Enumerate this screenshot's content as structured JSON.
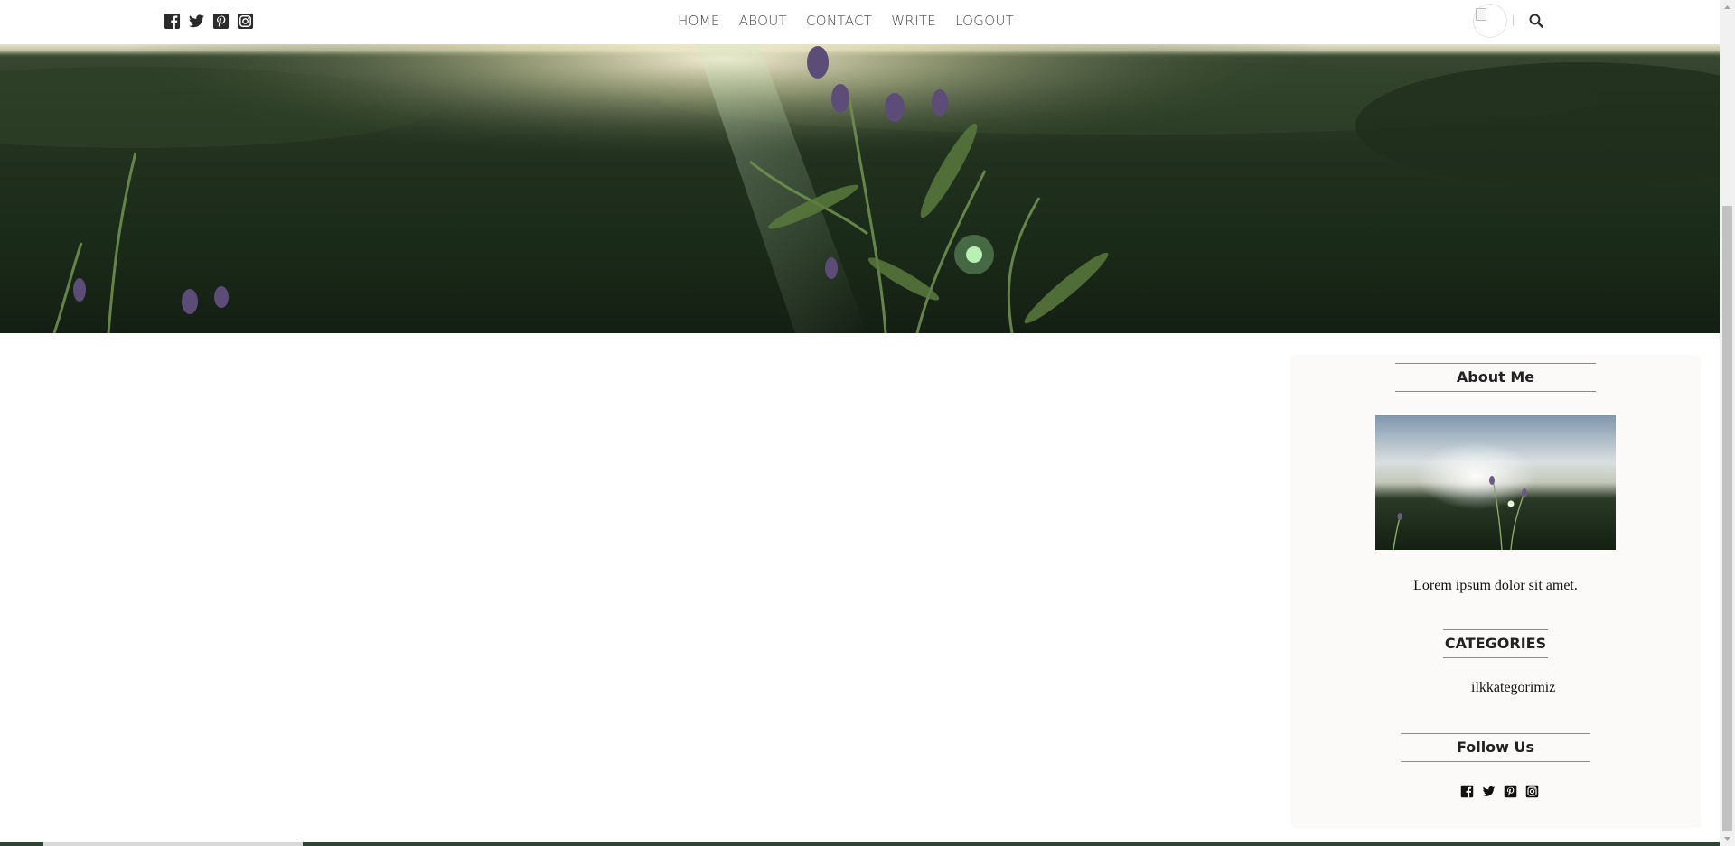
{
  "header": {
    "social_icons": [
      "facebook-square-icon",
      "twitter-icon",
      "pinterest-square-icon",
      "instagram-icon"
    ],
    "nav": [
      "HOME",
      "ABOUT",
      "CONTACT",
      "WRITE",
      "LOGOUT"
    ],
    "right_icons": [
      "avatar",
      "search-icon"
    ]
  },
  "sidebar": {
    "about": {
      "title": "About Me",
      "text": "Lorem ipsum dolor sit amet."
    },
    "categories": {
      "title": "CATEGORIES",
      "items": [
        "ilkkategorimiz"
      ]
    },
    "follow": {
      "title": "Follow Us",
      "icons": [
        "facebook-square-icon",
        "twitter-icon",
        "pinterest-square-icon",
        "instagram-icon"
      ]
    }
  },
  "colors": {
    "icon": "#222222",
    "nav_text": "#444444",
    "sidebar_bg": "#fcf9f9"
  }
}
